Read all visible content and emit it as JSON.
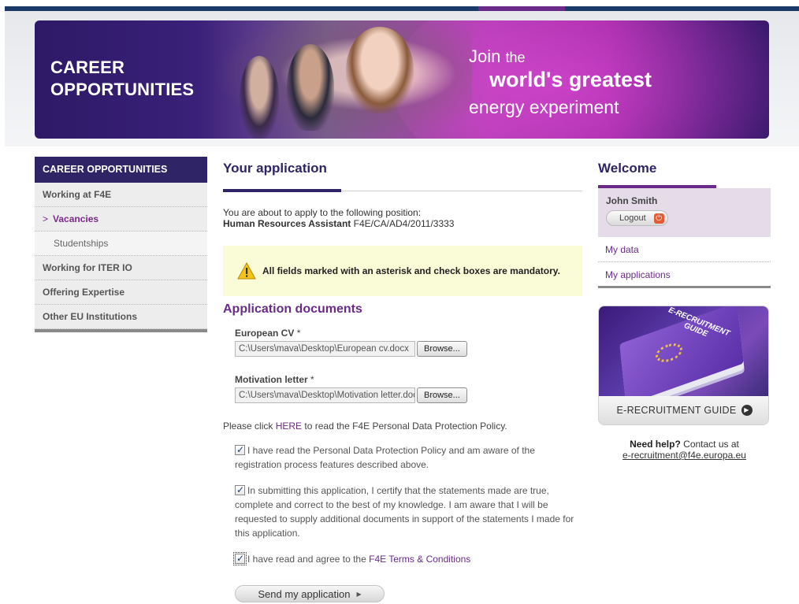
{
  "banner": {
    "title_line1": "CAREER",
    "title_line2": "OPPORTUNITIES",
    "tagline_join": "Join",
    "tagline_the": "the",
    "tagline_main": "world's greatest",
    "tagline_end": "energy experiment"
  },
  "leftnav": {
    "heading": "CAREER OPPORTUNITIES",
    "items": [
      {
        "label": "Working at F4E"
      },
      {
        "label": "Vacancies"
      },
      {
        "label": "Studentships"
      },
      {
        "label": "Working for ITER IO"
      },
      {
        "label": "Offering Expertise"
      },
      {
        "label": "Other EU Institutions"
      }
    ],
    "active_chevron": ">"
  },
  "main": {
    "title": "Your application",
    "intro_line1": "You are about to apply to the following position:",
    "position_title": "Human Resources Assistant",
    "position_ref": "F4E/CA/AD4/2011/3333",
    "notice": "All fields marked with an asterisk and check boxes are mandatory.",
    "docs_title": "Application documents",
    "cv_label": "European CV",
    "cv_value": "C:\\Users\\mava\\Desktop\\European cv.docx",
    "letter_label": "Motivation letter",
    "letter_value": "C:\\Users\\mava\\Desktop\\Motivation letter.docx",
    "asterisk": "*",
    "browse_label": "Browse...",
    "policy_prefix": "Please click",
    "policy_link": "HERE",
    "policy_suffix": "to read the F4E Personal Data Protection Policy.",
    "check1": "I have read the Personal Data Protection Policy and am aware of the registration process features described above.",
    "check2": "In submitting this application, I certify that the statements made are true, complete and correct to the best of my knowledge. I am aware that I will be requested to supply additional documents in support of the statements I made for this application.",
    "check3_prefix": "I have read and agree to the",
    "check3_link": "F4E Terms & Conditions",
    "send_label": "Send my application"
  },
  "right": {
    "welcome": "Welcome",
    "user_name": "John Smith",
    "logout_label": "Logout",
    "my_data": "My data",
    "my_applications": "My applications",
    "guide_book_line1": "E-RECRUITMENT",
    "guide_book_line2": "GUIDE",
    "guide_label": "E-RECRUITMENT GUIDE",
    "help_bold": "Need help?",
    "help_text": "Contact us at",
    "help_email": "e-recruitment@f4e.europa.eu"
  },
  "colors": {
    "navy": "#2e2466",
    "purple": "#6a2a8a",
    "notice_bg": "#fafbd7",
    "user_bg": "#e6dbe9"
  }
}
